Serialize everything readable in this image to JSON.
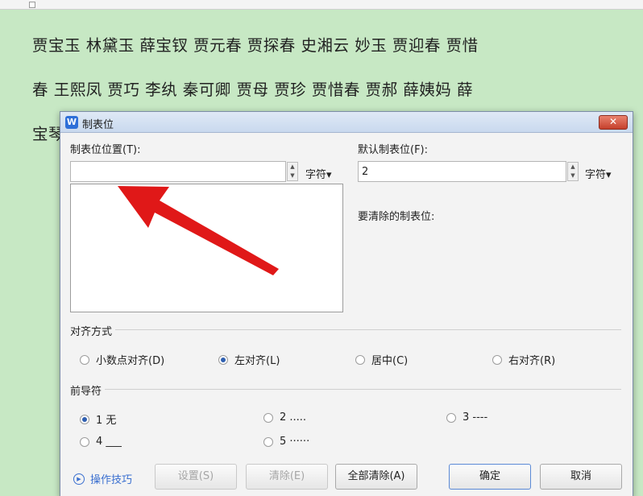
{
  "document": {
    "line1": "贾宝玉 林黛玉 薛宝钗 贾元春 贾探春 史湘云 妙玉 贾迎春 贾惜",
    "line2": "春 王熙凤 贾巧 李纨 秦可卿 贾母 贾珍 贾惜春 贾郝 薛姨妈 薛",
    "line3": "宝琴"
  },
  "dialog": {
    "app_icon_glyph": "W",
    "title": "制表位",
    "close_glyph": "✕",
    "tab_position_label": "制表位位置(T):",
    "tab_position_value": "",
    "tab_position_unit": "字符▾",
    "default_tab_label": "默认制表位(F):",
    "default_tab_value": "2",
    "default_tab_unit": "字符▾",
    "clear_label": "要清除的制表位:",
    "alignment": {
      "label": "对齐方式",
      "options": [
        {
          "label": "小数点对齐(D)",
          "selected": false
        },
        {
          "label": "左对齐(L)",
          "selected": true
        },
        {
          "label": "居中(C)",
          "selected": false
        },
        {
          "label": "右对齐(R)",
          "selected": false
        }
      ]
    },
    "leader": {
      "label": "前导符",
      "options": [
        {
          "label": "1 无",
          "selected": true
        },
        {
          "label": "2 .....",
          "selected": false
        },
        {
          "label": "3 ----",
          "selected": false
        },
        {
          "label": "4 ___",
          "selected": false
        },
        {
          "label": "5 ······",
          "selected": false
        }
      ]
    },
    "tips_label": "操作技巧",
    "buttons": {
      "set": "设置(S)",
      "clear": "清除(E)",
      "clear_all": "全部清除(A)",
      "ok": "确定",
      "cancel": "取消"
    }
  },
  "colors": {
    "document_background": "#c7e8c4",
    "annotation_arrow": "#e01818"
  }
}
